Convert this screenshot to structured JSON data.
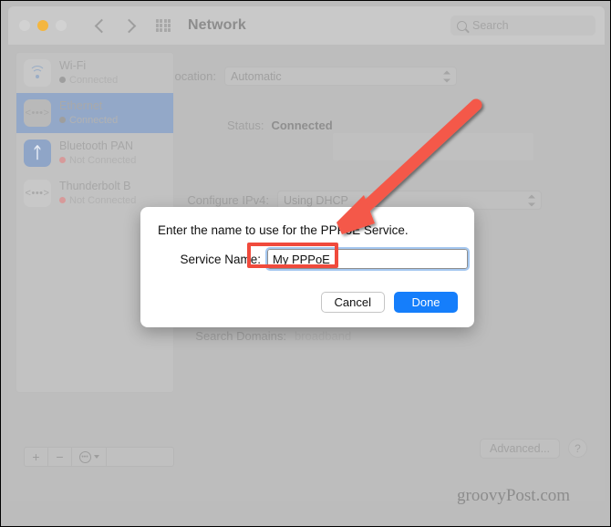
{
  "window": {
    "title": "Network",
    "traffic_lights": [
      "close-red-disabled",
      "minimize-amber",
      "zoom-green-disabled"
    ],
    "nav_back": "‹",
    "nav_forward": "›",
    "grid_icon": "grid-icon"
  },
  "search": {
    "placeholder": "Search",
    "icon": "search-icon"
  },
  "main": {
    "location_label": "Location:",
    "location_value": "Automatic",
    "status_label": "Status:",
    "status_value": "Connected",
    "configure_ipv4_label": "Configure IPv4:",
    "configure_ipv4_value": "Using DHCP",
    "search_domains_label": "Search Domains:",
    "search_domains_value": "broadband",
    "advanced_button": "Advanced...",
    "help_button": "?"
  },
  "sidebar": {
    "items": [
      {
        "name": "Wi-Fi",
        "status": "Connected",
        "icon": "wifi-icon",
        "selected": false,
        "status_kind": "connected"
      },
      {
        "name": "Ethernet",
        "status": "Connected",
        "icon": "ethernet-icon",
        "selected": true,
        "status_kind": "connected"
      },
      {
        "name": "Bluetooth PAN",
        "status": "Not Connected",
        "icon": "bluetooth-icon",
        "selected": false,
        "status_kind": "not-connected"
      },
      {
        "name": "Thunderbolt B",
        "status": "Not Connected",
        "icon": "thunderbolt-icon",
        "selected": false,
        "status_kind": "not-connected"
      }
    ],
    "toolbar": {
      "add": "+",
      "remove": "−",
      "actions_icon": "gear-icon",
      "actions_caret": "chevron-down-icon"
    }
  },
  "dialog": {
    "title": "Enter the name to use for the PPPoE Service.",
    "field_label": "Service Name:",
    "field_value": "My PPPoE",
    "cancel_label": "Cancel",
    "done_label": "Done"
  },
  "annotation": {
    "arrow": "red-arrow-pointing-to-service-name-field",
    "highlight_box": "red-rectangle-around-service-name-value",
    "accent_color": "#f04a3c"
  },
  "watermark": {
    "text": "groovyPost.com"
  },
  "colors": {
    "selected_row": "#93a8c8",
    "primary_button": "#157efb",
    "dimmed_background": "#bdbdbd"
  }
}
